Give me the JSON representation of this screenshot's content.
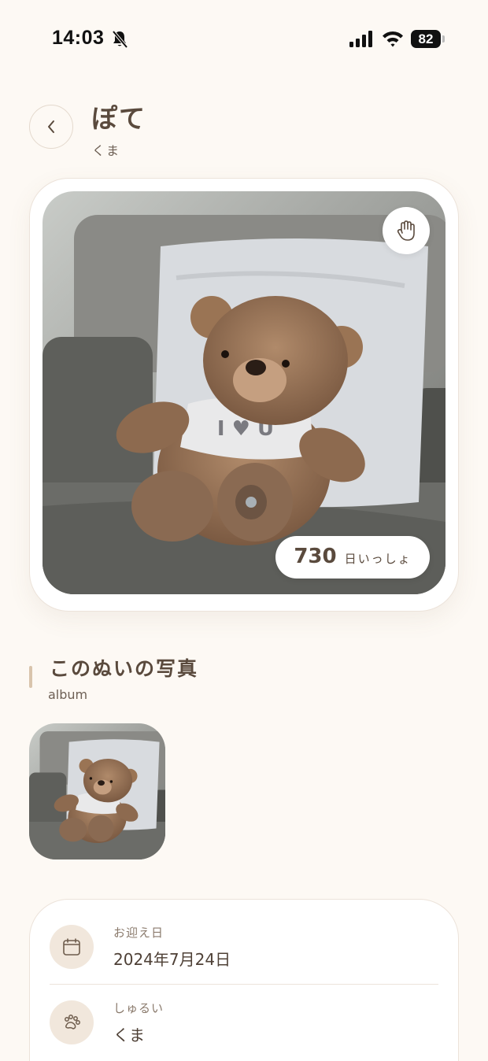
{
  "status_bar": {
    "time": "14:03",
    "battery": "82",
    "icons": [
      "bell-slash-icon",
      "cellular-signal-icon",
      "wifi-icon",
      "battery-icon"
    ]
  },
  "header": {
    "title": "ぽて",
    "subtitle": "くま",
    "back_icon": "chevron-left-icon"
  },
  "hero": {
    "photo_subject": "teddy-bear-photo",
    "hand_icon": "hand-icon",
    "days_number": "730",
    "days_label": "日いっしょ"
  },
  "album": {
    "title": "このぬいの写真",
    "subtitle": "album",
    "photos": [
      "teddy-bear-photo"
    ]
  },
  "info": {
    "rows": [
      {
        "icon": "calendar-icon",
        "label": "お迎え日",
        "value": "2024年7月24日"
      },
      {
        "icon": "paw-icon",
        "label": "しゅるい",
        "value": "くま"
      }
    ]
  },
  "colors": {
    "background": "#fdf9f4",
    "text": "#5a4a3d",
    "accent": "#d9c4ac",
    "icon_bg": "#f1e7dc"
  }
}
